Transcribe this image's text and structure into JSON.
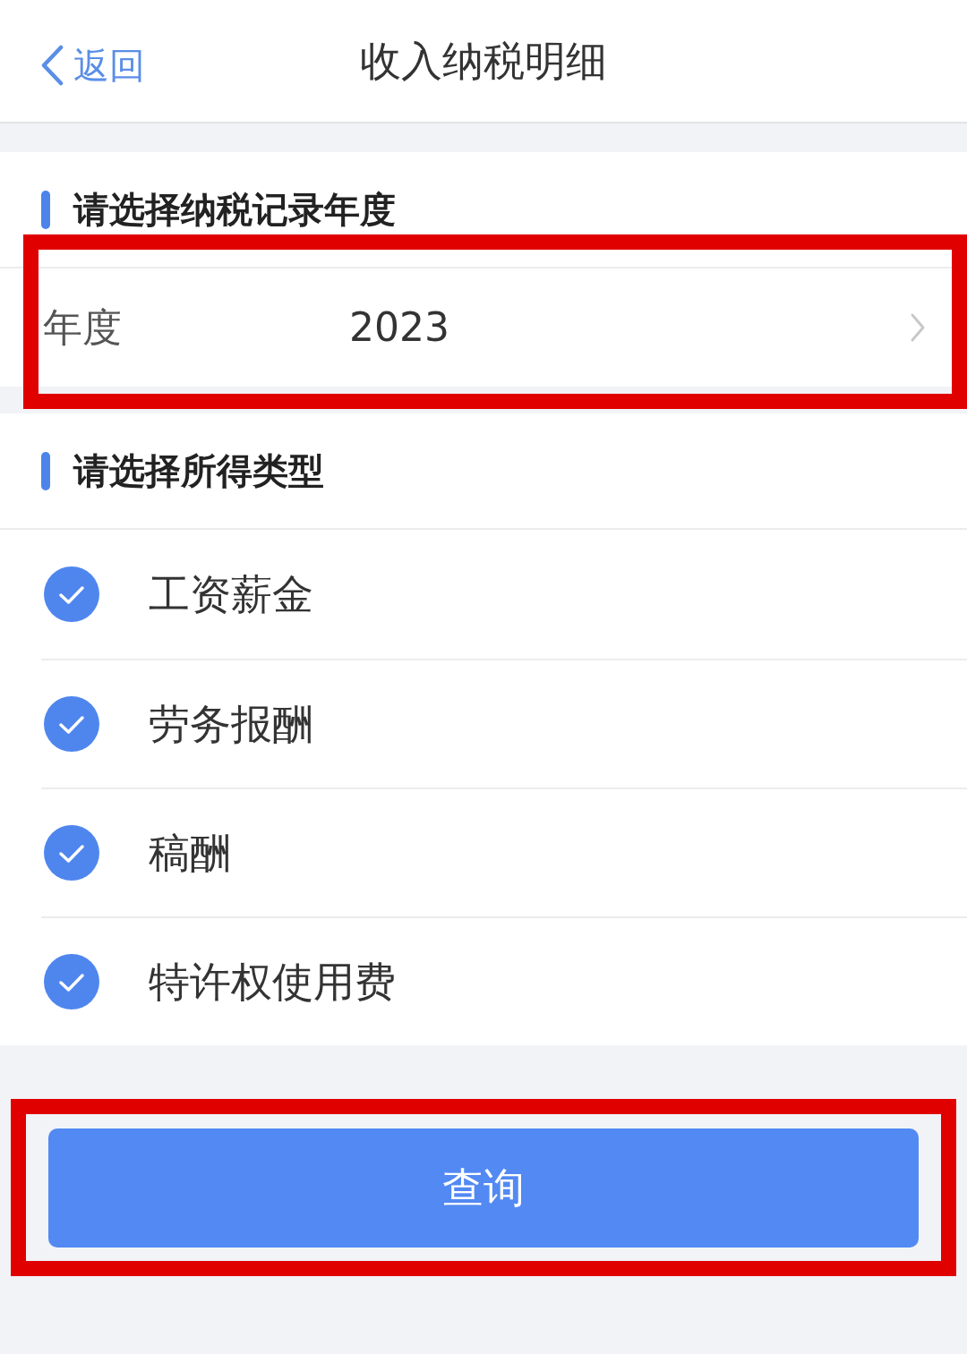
{
  "header": {
    "back_label": "返回",
    "title": "收入纳税明细"
  },
  "year_section": {
    "heading": "请选择纳税记录年度",
    "field": {
      "label": "年度",
      "value": "2023",
      "highlighted": true
    }
  },
  "income_section": {
    "heading": "请选择所得类型",
    "options": [
      {
        "label": "工资薪金",
        "checked": true
      },
      {
        "label": "劳务报酬",
        "checked": true
      },
      {
        "label": "稿酬",
        "checked": true
      },
      {
        "label": "特许权使用费",
        "checked": true
      }
    ]
  },
  "query_button": {
    "label": "查询",
    "highlighted": true
  }
}
